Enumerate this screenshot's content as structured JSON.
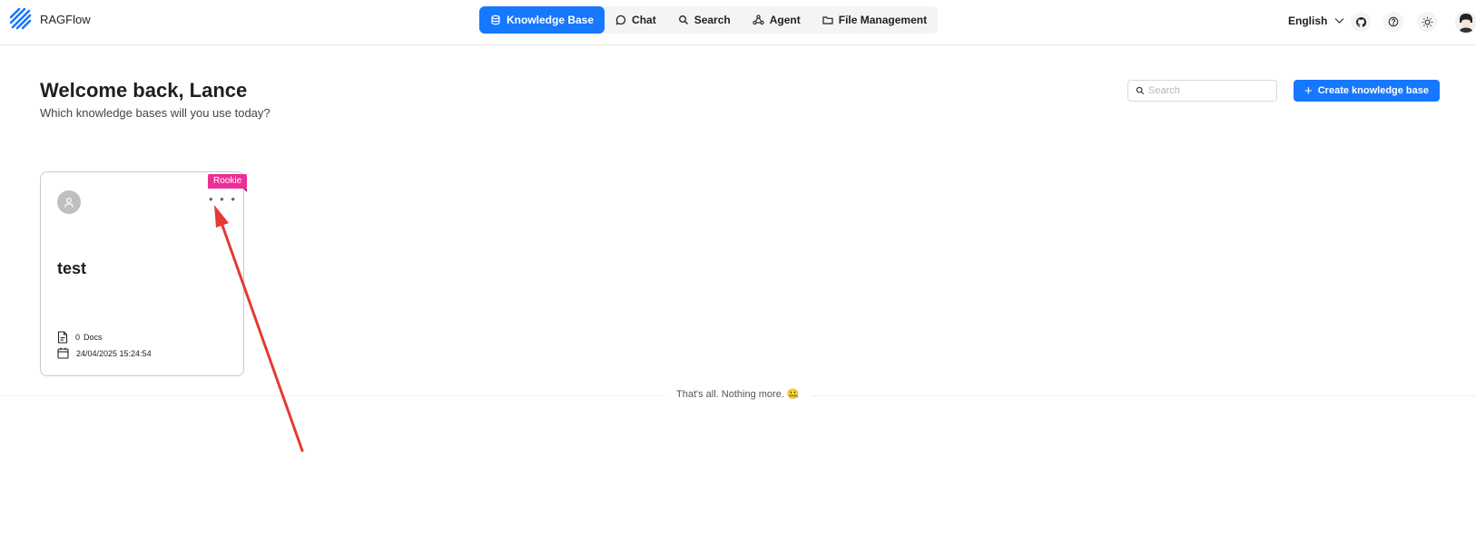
{
  "app": {
    "name": "RAGFlow"
  },
  "nav": {
    "items": [
      {
        "label": "Knowledge Base",
        "icon": "database-icon",
        "active": true
      },
      {
        "label": "Chat",
        "icon": "chat-bubble-icon",
        "active": false
      },
      {
        "label": "Search",
        "icon": "search-icon",
        "active": false
      },
      {
        "label": "Agent",
        "icon": "agent-graph-icon",
        "active": false
      },
      {
        "label": "File Management",
        "icon": "folder-icon",
        "active": false
      }
    ]
  },
  "header_right": {
    "language": "English",
    "icons": [
      "github-icon",
      "help-circle-icon",
      "sun-icon",
      "user-avatar"
    ]
  },
  "welcome": {
    "title": "Welcome back, Lance",
    "subtitle": "Which knowledge bases will you use today?"
  },
  "toolbar": {
    "search_placeholder": "Search",
    "create_label": "Create knowledge base"
  },
  "knowledge_bases": [
    {
      "name": "test",
      "badge": "Rookie",
      "doc_count": "0",
      "doc_label": "Docs",
      "updated": "24/04/2025 15:24:54"
    }
  ],
  "footer": {
    "end_text": "That's all. Nothing more. 🤐"
  },
  "colors": {
    "accent": "#1677ff",
    "badge": "#eb2f96",
    "annotation_arrow": "#e53935"
  }
}
